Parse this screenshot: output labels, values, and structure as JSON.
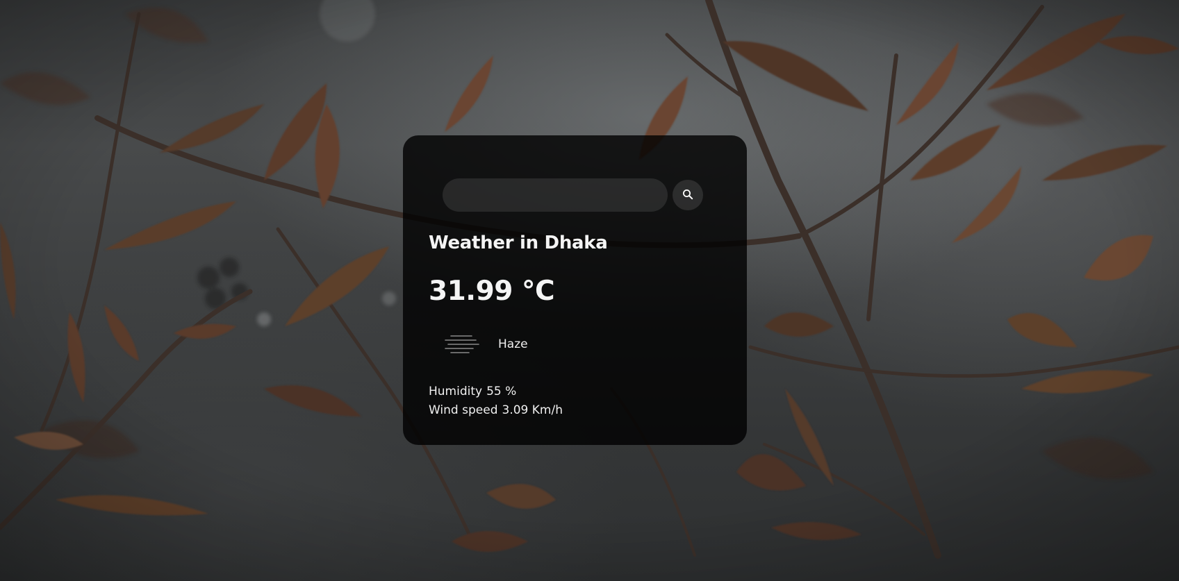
{
  "search": {
    "value": "",
    "placeholder": "",
    "icon": "search-icon"
  },
  "weather": {
    "title": "Weather in Dhaka",
    "temperature": "31.99 °C",
    "condition": "Haze",
    "condition_icon": "haze-icon",
    "humidity_label": "Humidity",
    "humidity_value": "55 %",
    "wind_label": "Wind speed",
    "wind_value": "3.09 Km/h"
  },
  "colors": {
    "card_background": "#000000",
    "text": "#ffffff",
    "leaf": "#5a3a26",
    "branch": "#3a2f2a"
  }
}
